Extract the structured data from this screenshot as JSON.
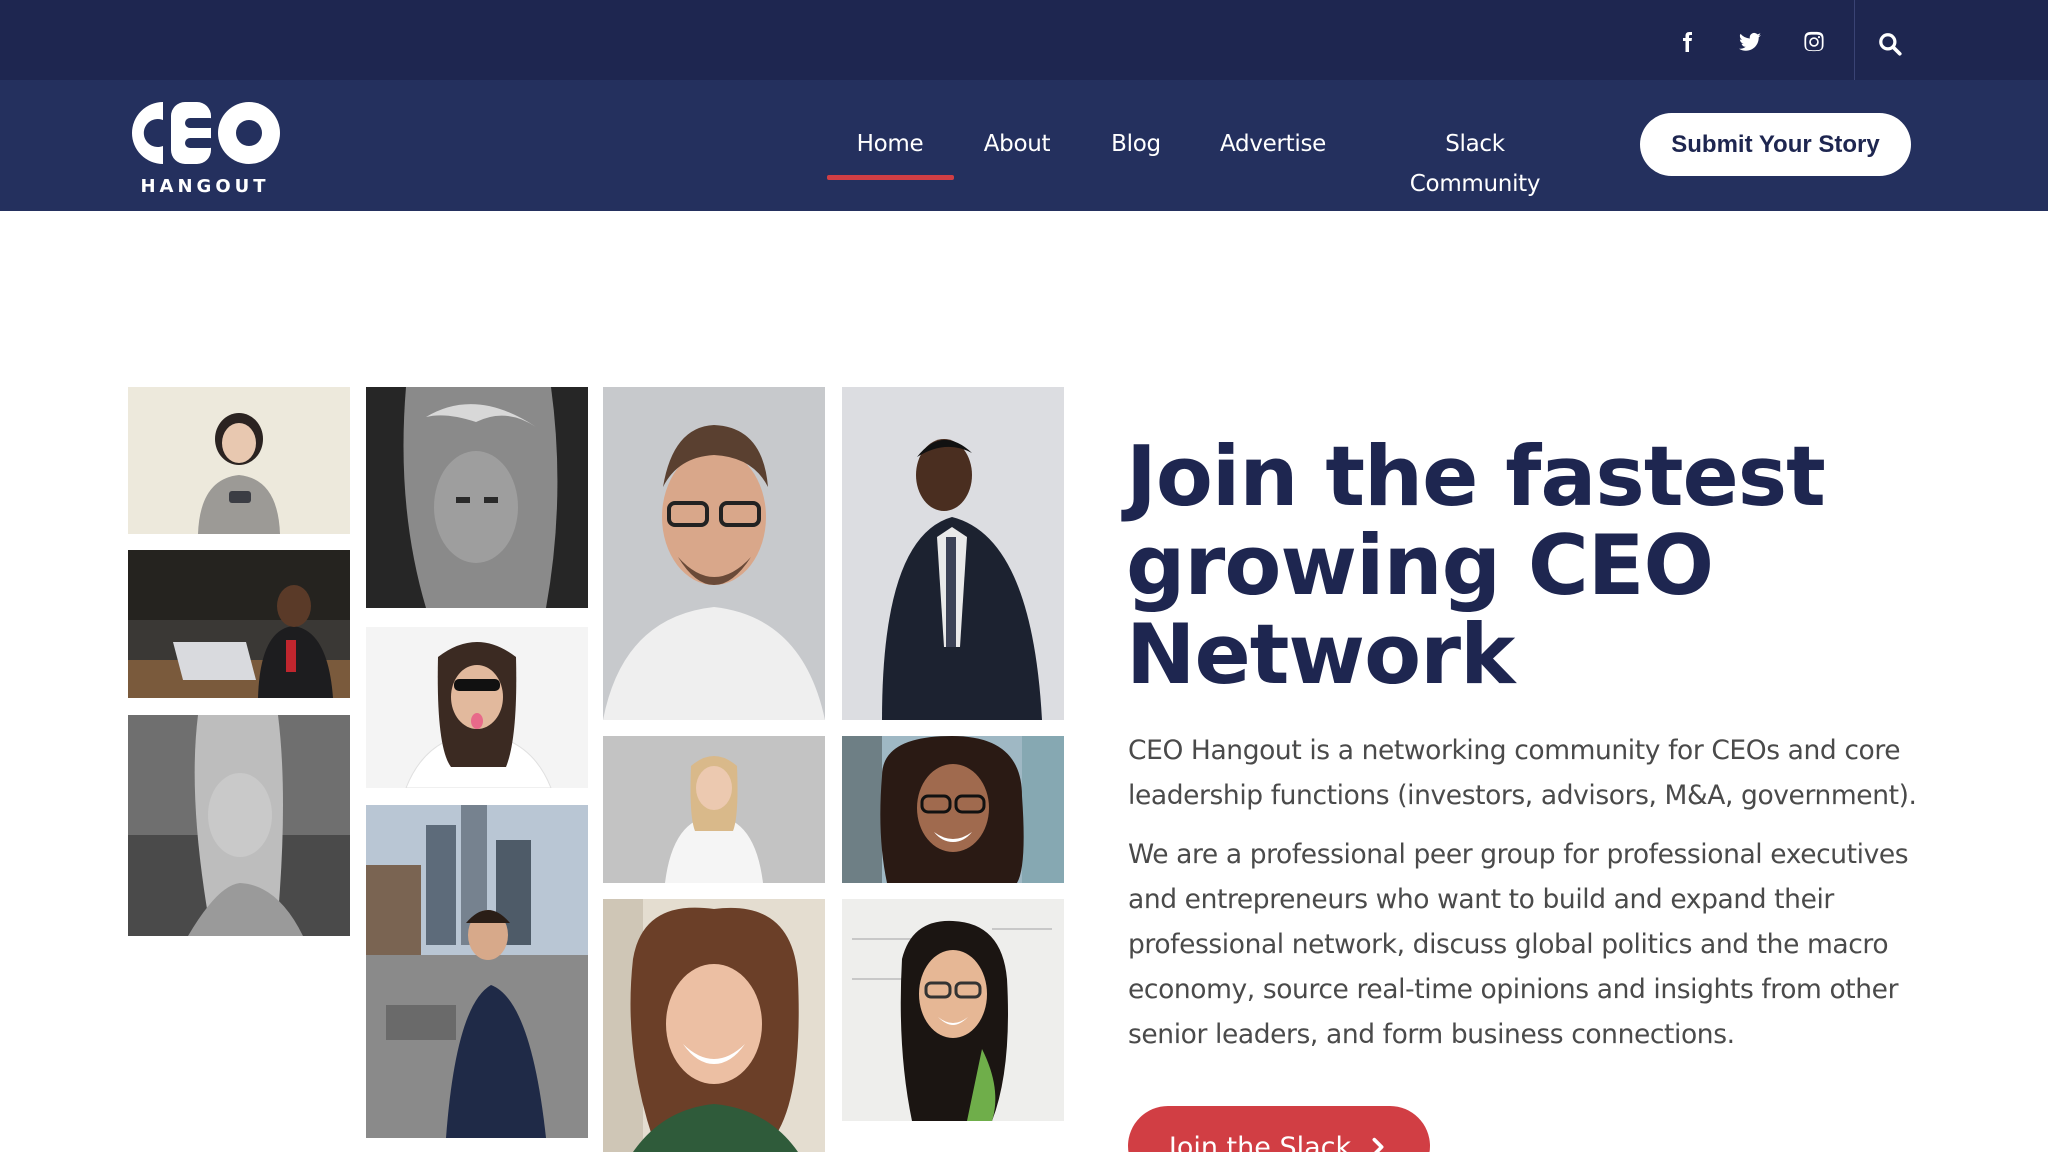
{
  "topbar": {
    "social_icons": [
      "facebook-icon",
      "twitter-icon",
      "instagram-icon"
    ],
    "search_icon": "search-icon"
  },
  "brand": {
    "logo_text": "CEO",
    "logo_subtext": "HANGOUT"
  },
  "nav": {
    "items": [
      {
        "label": "Home",
        "active": true
      },
      {
        "label": "About",
        "active": false
      },
      {
        "label": "Blog",
        "active": false
      },
      {
        "label": "Advertise",
        "active": false
      },
      {
        "label": "Slack Community",
        "active": false
      }
    ],
    "cta_label": "Submit Your Story"
  },
  "hero": {
    "headline": "Join the fastest growing CEO Network",
    "paragraph_1": "CEO Hangout is a networking community for CEOs and core leadership functions (investors, advisors, M&A, government).",
    "paragraph_2": "We are a professional peer group for professional executives and entrepreneurs who want to build and expand their professional network, discuss global politics and the macro economy, source real-time opinions and insights from other senior leaders, and form business connections.",
    "cta_label": "Join the Slack",
    "cta_icon": "chevron-right-icon"
  },
  "colors": {
    "topbar_bg": "#1e2650",
    "navbar_bg": "#24305e",
    "accent_red": "#d13e44",
    "headline_navy": "#1e2650",
    "body_text": "#4a4a4a"
  }
}
